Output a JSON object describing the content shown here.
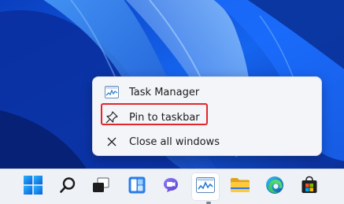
{
  "desktop": {
    "wallpaper": "windows-11-bloom-blue"
  },
  "jumplist": {
    "app_name": "Task Manager",
    "app_icon": "task-manager-icon",
    "pin_label": "Pin to taskbar",
    "pin_icon": "pin-icon",
    "close_label": "Close all windows",
    "close_icon": "close-icon",
    "highlight_color": "#e3262b"
  },
  "taskbar": {
    "items": [
      {
        "name": "start",
        "icon": "windows-logo-icon"
      },
      {
        "name": "search",
        "icon": "search-icon"
      },
      {
        "name": "task-view",
        "icon": "task-view-icon"
      },
      {
        "name": "widgets",
        "icon": "widgets-icon"
      },
      {
        "name": "chat",
        "icon": "teams-chat-icon"
      },
      {
        "name": "task-manager",
        "icon": "task-manager-icon",
        "active": true
      },
      {
        "name": "file-explorer",
        "icon": "folder-icon"
      },
      {
        "name": "edge",
        "icon": "edge-icon"
      },
      {
        "name": "store",
        "icon": "store-icon"
      }
    ]
  }
}
